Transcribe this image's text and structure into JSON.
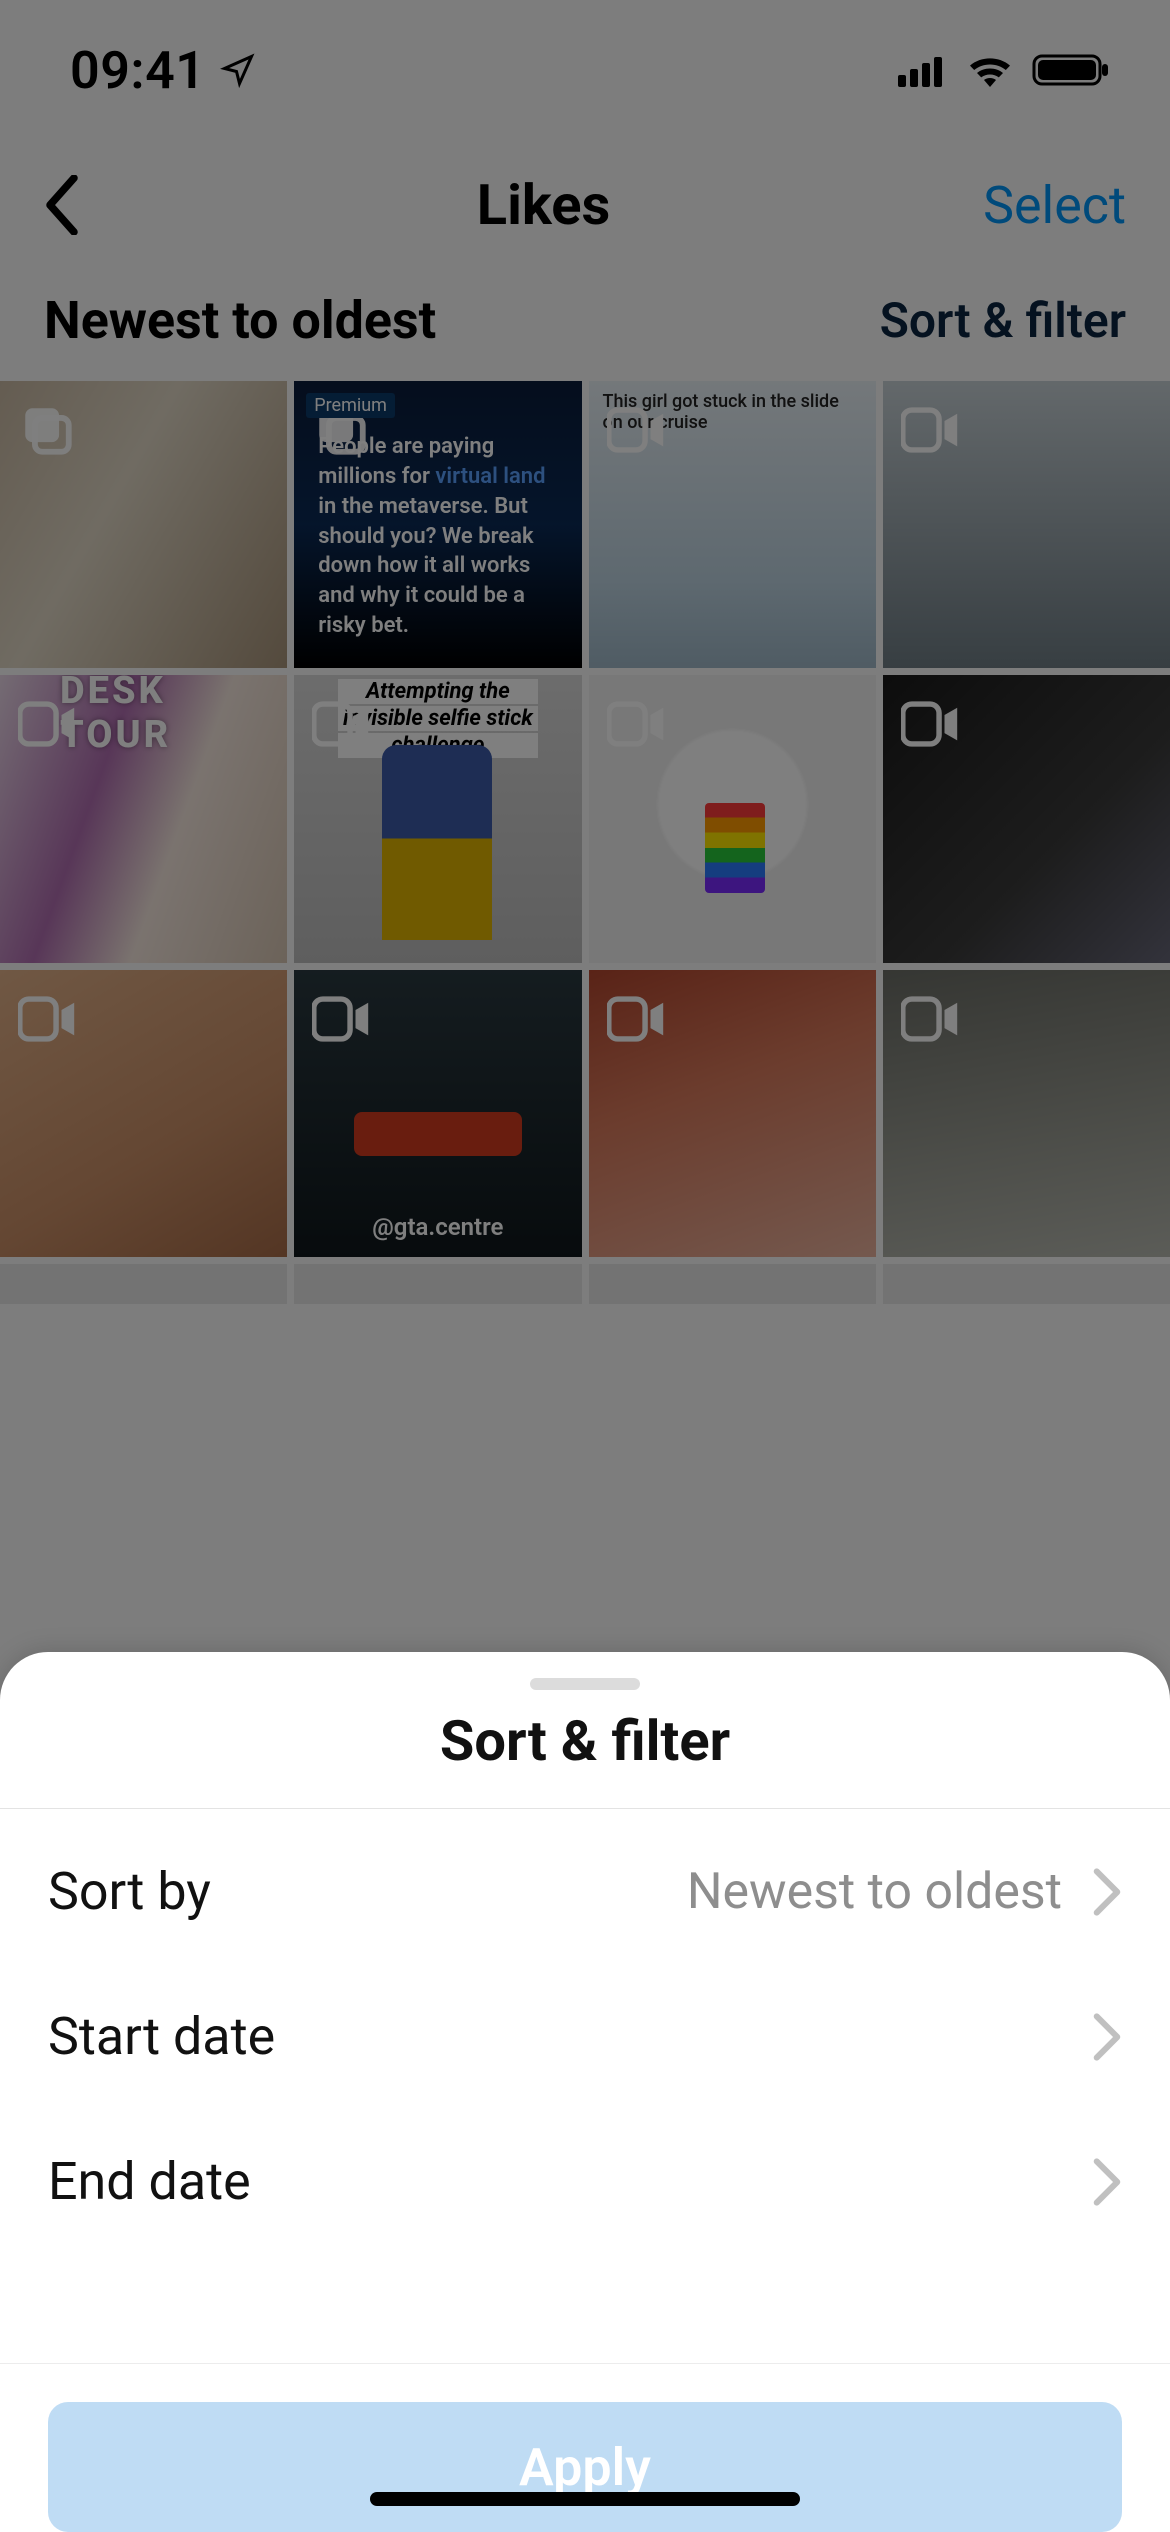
{
  "status_bar": {
    "time": "09:41"
  },
  "nav": {
    "title": "Likes",
    "select_label": "Select"
  },
  "subheader": {
    "sort_label": "Newest to oldest",
    "filter_label": "Sort & filter"
  },
  "grid": {
    "tiles": {
      "t2_premium": "Premium",
      "t2_copy_pre": "People are paying millions for ",
      "t2_copy_hl": "virtual land",
      "t2_copy_post": " in the metaverse. But should you? We break down how it all works and why it could be a risky bet.",
      "t3_caption": "This girl got stuck in the slide on our cruise",
      "t5_caption": "DESK TOUR",
      "t6_line1": "Attempting the",
      "t6_line2": "invisible selfie stick",
      "t6_line3": "challenge",
      "t10_tag": "@gta.centre"
    }
  },
  "sheet": {
    "title": "Sort & filter",
    "rows": {
      "sort_by_label": "Sort by",
      "sort_by_value": "Newest to oldest",
      "start_date_label": "Start date",
      "end_date_label": "End date"
    },
    "apply_label": "Apply"
  }
}
